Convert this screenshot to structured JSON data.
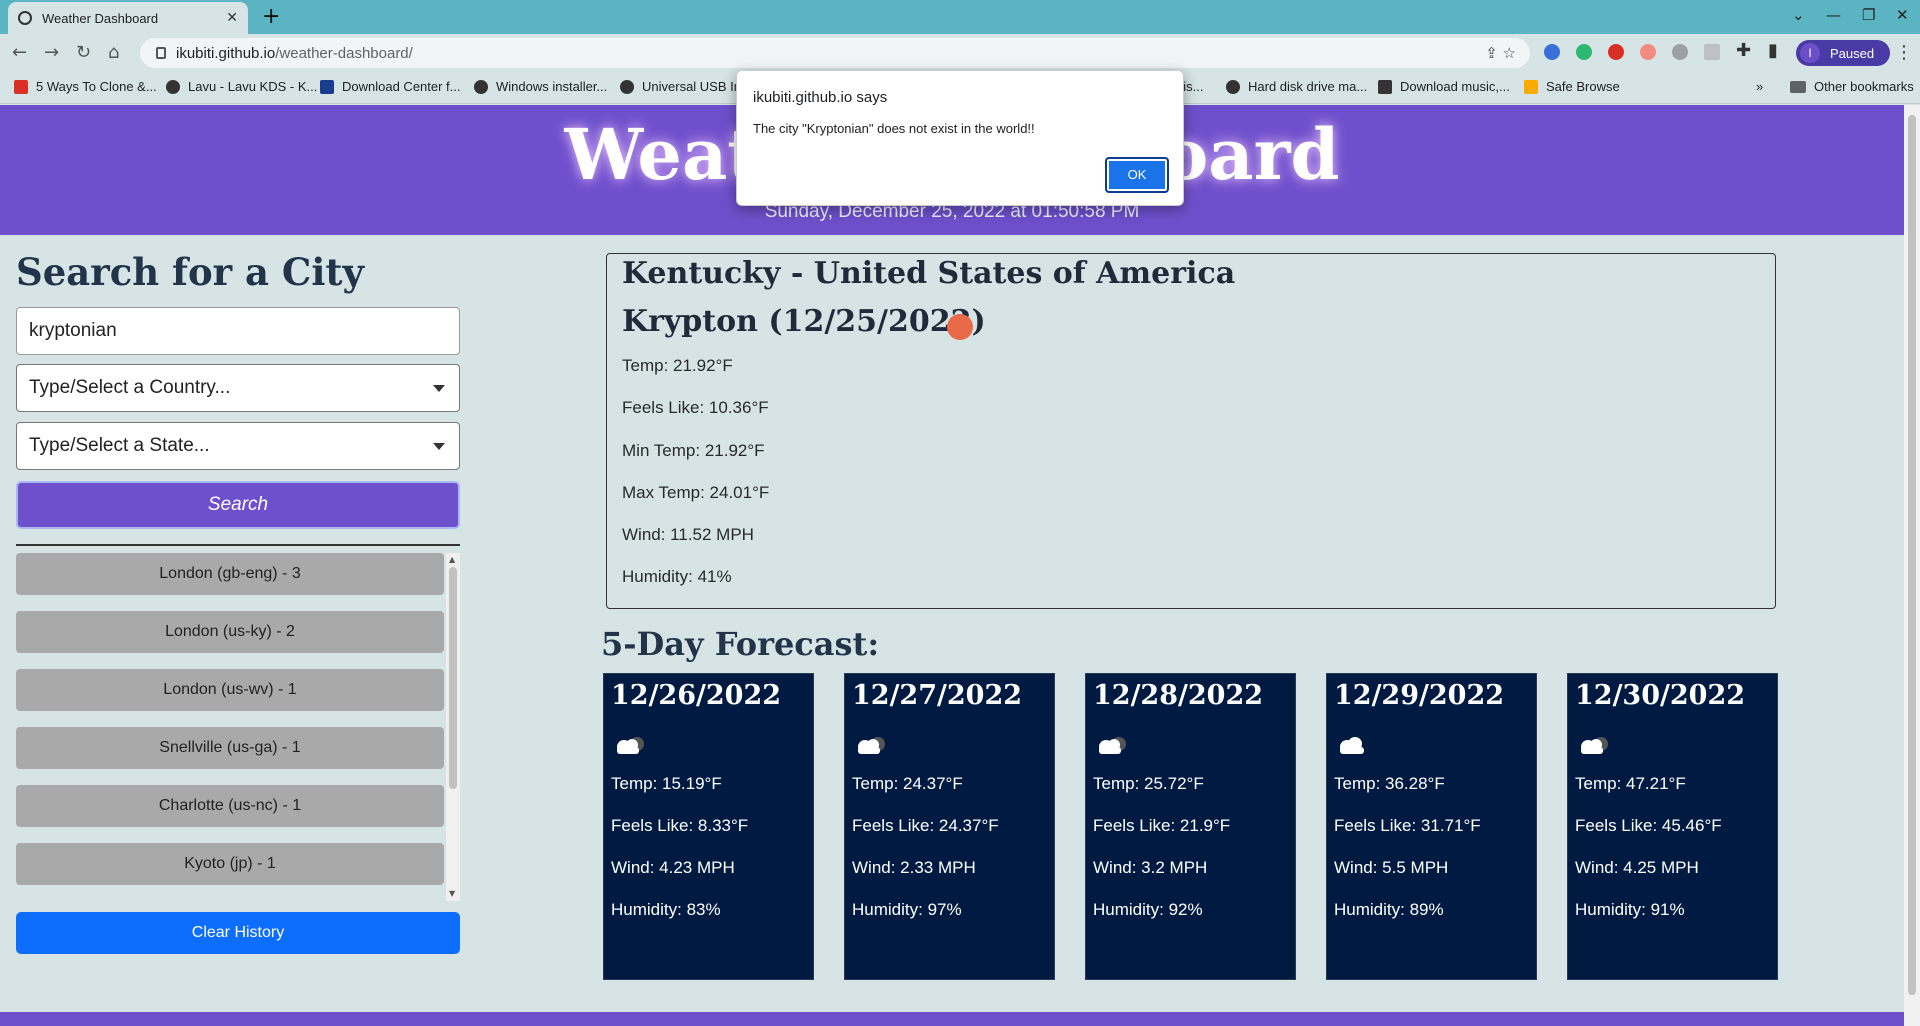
{
  "browser": {
    "tab_title": "Weather Dashboard",
    "url_host": "ikubiti.github.io",
    "url_path": "/weather-dashboard/",
    "profile_label": "Paused",
    "profile_initial": "I",
    "bookmarks": [
      "5 Ways To Clone &...",
      "Lavu - Lavu KDS - K...",
      "Download Center f...",
      "Windows installer...",
      "Universal USB In",
      "dis...",
      "Hard disk drive ma...",
      "Download music,...",
      "Safe Browse"
    ],
    "other_bookmarks": "Other bookmarks"
  },
  "header": {
    "title": "Weather Dashboard",
    "datetime": "Sunday, December 25, 2022 at 01:50:58 PM"
  },
  "search": {
    "title": "Search for a City",
    "city_value": "kryptonian",
    "country_placeholder": "Type/Select a Country...",
    "state_placeholder": "Type/Select a State...",
    "search_label": "Search",
    "clear_label": "Clear History"
  },
  "history": [
    "London (gb-eng) - 3",
    "London (us-ky) - 2",
    "London (us-wv) - 1",
    "Snellville (us-ga) - 1",
    "Charlotte (us-nc) - 1",
    "Kyoto (jp) - 1"
  ],
  "current": {
    "location": "Kentucky - United States of America",
    "city_date": "Krypton (12/25/2022)",
    "temp": "Temp: 21.92°F",
    "feels": "Feels Like: 10.36°F",
    "min": "Min Temp: 21.92°F",
    "max": "Max Temp: 24.01°F",
    "wind": "Wind: 11.52 MPH",
    "humidity": "Humidity: 41%"
  },
  "forecast": {
    "title": "5-Day Forecast:",
    "days": [
      {
        "date": "12/26/2022",
        "temp": "Temp: 15.19°F",
        "feels": "Feels Like: 8.33°F",
        "wind": "Wind: 4.23 MPH",
        "humidity": "Humidity: 83%"
      },
      {
        "date": "12/27/2022",
        "temp": "Temp: 24.37°F",
        "feels": "Feels Like: 24.37°F",
        "wind": "Wind: 2.33 MPH",
        "humidity": "Humidity: 97%"
      },
      {
        "date": "12/28/2022",
        "temp": "Temp: 25.72°F",
        "feels": "Feels Like: 21.9°F",
        "wind": "Wind: 3.2 MPH",
        "humidity": "Humidity: 92%"
      },
      {
        "date": "12/29/2022",
        "temp": "Temp: 36.28°F",
        "feels": "Feels Like: 31.71°F",
        "wind": "Wind: 5.5 MPH",
        "humidity": "Humidity: 89%"
      },
      {
        "date": "12/30/2022",
        "temp": "Temp: 47.21°F",
        "feels": "Feels Like: 45.46°F",
        "wind": "Wind: 4.25 MPH",
        "humidity": "Humidity: 91%"
      }
    ]
  },
  "dialog": {
    "origin": "ikubiti.github.io says",
    "message": "The city \"Kryptonian\" does not exist in the world!!",
    "ok_label": "OK"
  },
  "colors": {
    "header": "#6f50cc",
    "card": "#011a42",
    "clear_button": "#0d6efd",
    "history_item": "#a9a9a9",
    "weather_icon_current": "#e86a48"
  }
}
